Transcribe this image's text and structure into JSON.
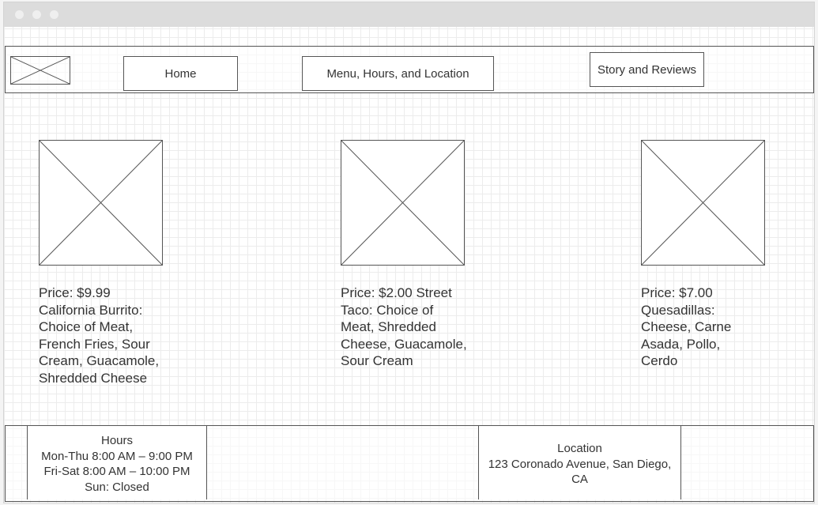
{
  "nav": {
    "logo_icon": "image-placeholder-icon",
    "home_label": "Home",
    "menu_label": "Menu, Hours, and Location",
    "story_label": "Story and Reviews"
  },
  "items": [
    {
      "image_icon": "image-placeholder-icon",
      "price": "Price: $9.99",
      "description": "California Burrito: Choice of Meat, French Fries, Sour Cream, Guacamole, Shredded Cheese"
    },
    {
      "image_icon": "image-placeholder-icon",
      "price": "Price: $2.00",
      "description": "Street Taco: Choice of Meat, Shredded Cheese, Guacamole, Sour Cream"
    },
    {
      "image_icon": "image-placeholder-icon",
      "price": "Price: $7.00",
      "description": "Quesadillas: Cheese, Carne Asada, Pollo, Cerdo"
    }
  ],
  "footer": {
    "hours_title": "Hours",
    "hours_lines": [
      "Mon-Thu 8:00 AM – 9:00 PM",
      "Fri-Sat 8:00 AM – 10:00 PM",
      "Sun: Closed"
    ],
    "location_title": "Location",
    "location_address": "123 Coronado Avenue, San Diego, CA"
  }
}
